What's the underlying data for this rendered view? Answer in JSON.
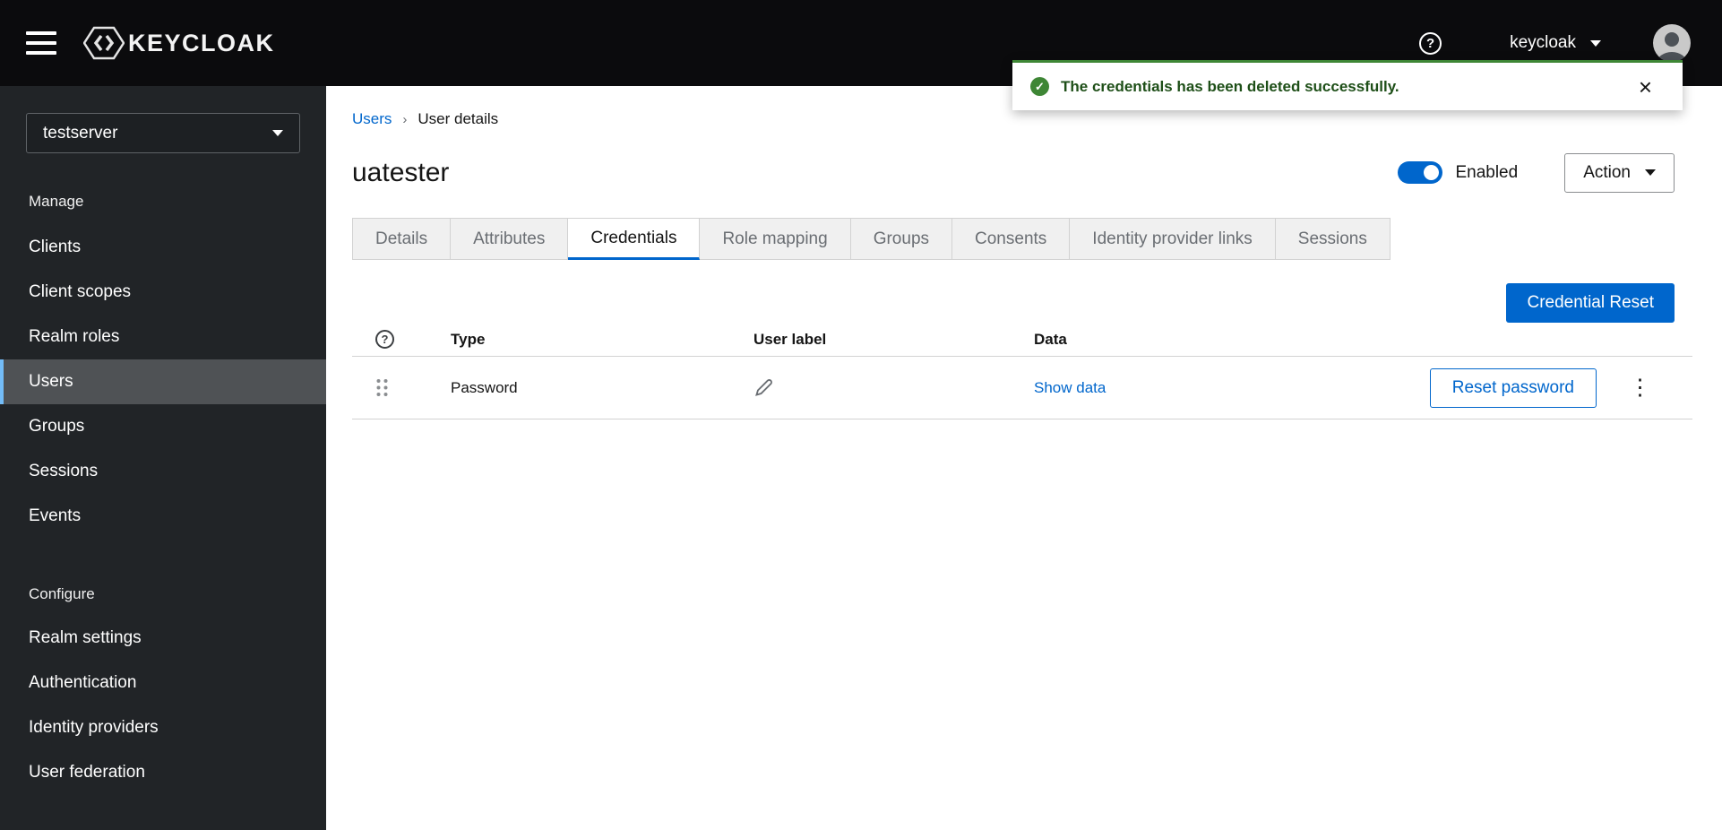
{
  "header": {
    "logo_text": "KEYCLOAK",
    "user_menu_label": "keycloak"
  },
  "toast": {
    "message": "The credentials has been deleted successfully."
  },
  "sidebar": {
    "realm_selector": {
      "value": "testserver"
    },
    "sections": [
      {
        "title": "Manage",
        "items": [
          {
            "label": "Clients"
          },
          {
            "label": "Client scopes"
          },
          {
            "label": "Realm roles"
          },
          {
            "label": "Users"
          },
          {
            "label": "Groups"
          },
          {
            "label": "Sessions"
          },
          {
            "label": "Events"
          }
        ]
      },
      {
        "title": "Configure",
        "items": [
          {
            "label": "Realm settings"
          },
          {
            "label": "Authentication"
          },
          {
            "label": "Identity providers"
          },
          {
            "label": "User federation"
          }
        ]
      }
    ],
    "active_item": "Users"
  },
  "breadcrumb": {
    "link": "Users",
    "current": "User details"
  },
  "user_details": {
    "title": "uatester",
    "enabled_label": "Enabled",
    "enabled_state": "on",
    "action_button": "Action"
  },
  "tabs": [
    {
      "label": "Details"
    },
    {
      "label": "Attributes"
    },
    {
      "label": "Credentials"
    },
    {
      "label": "Role mapping"
    },
    {
      "label": "Groups"
    },
    {
      "label": "Consents"
    },
    {
      "label": "Identity provider links"
    },
    {
      "label": "Sessions"
    }
  ],
  "active_tab": "Credentials",
  "credentials": {
    "credential_reset_button": "Credential Reset",
    "table": {
      "columns": {
        "type": "Type",
        "user_label": "User label",
        "data": "Data"
      },
      "row": {
        "type": "Password",
        "data_link": "Show data",
        "reset_button": "Reset password"
      }
    }
  },
  "icons": {
    "header_help": "?",
    "table_help": "?",
    "toast_check": "✓",
    "toast_close": "×",
    "kebab": "⋮",
    "breadcrumb_separator": "›"
  },
  "colors": {
    "accent_blue": "#0066cc",
    "success_green": "#3e8635",
    "active_nav_accent": "#73bcf7",
    "masthead_bg": "#0b0b0d",
    "sidebar_bg": "#212427"
  }
}
